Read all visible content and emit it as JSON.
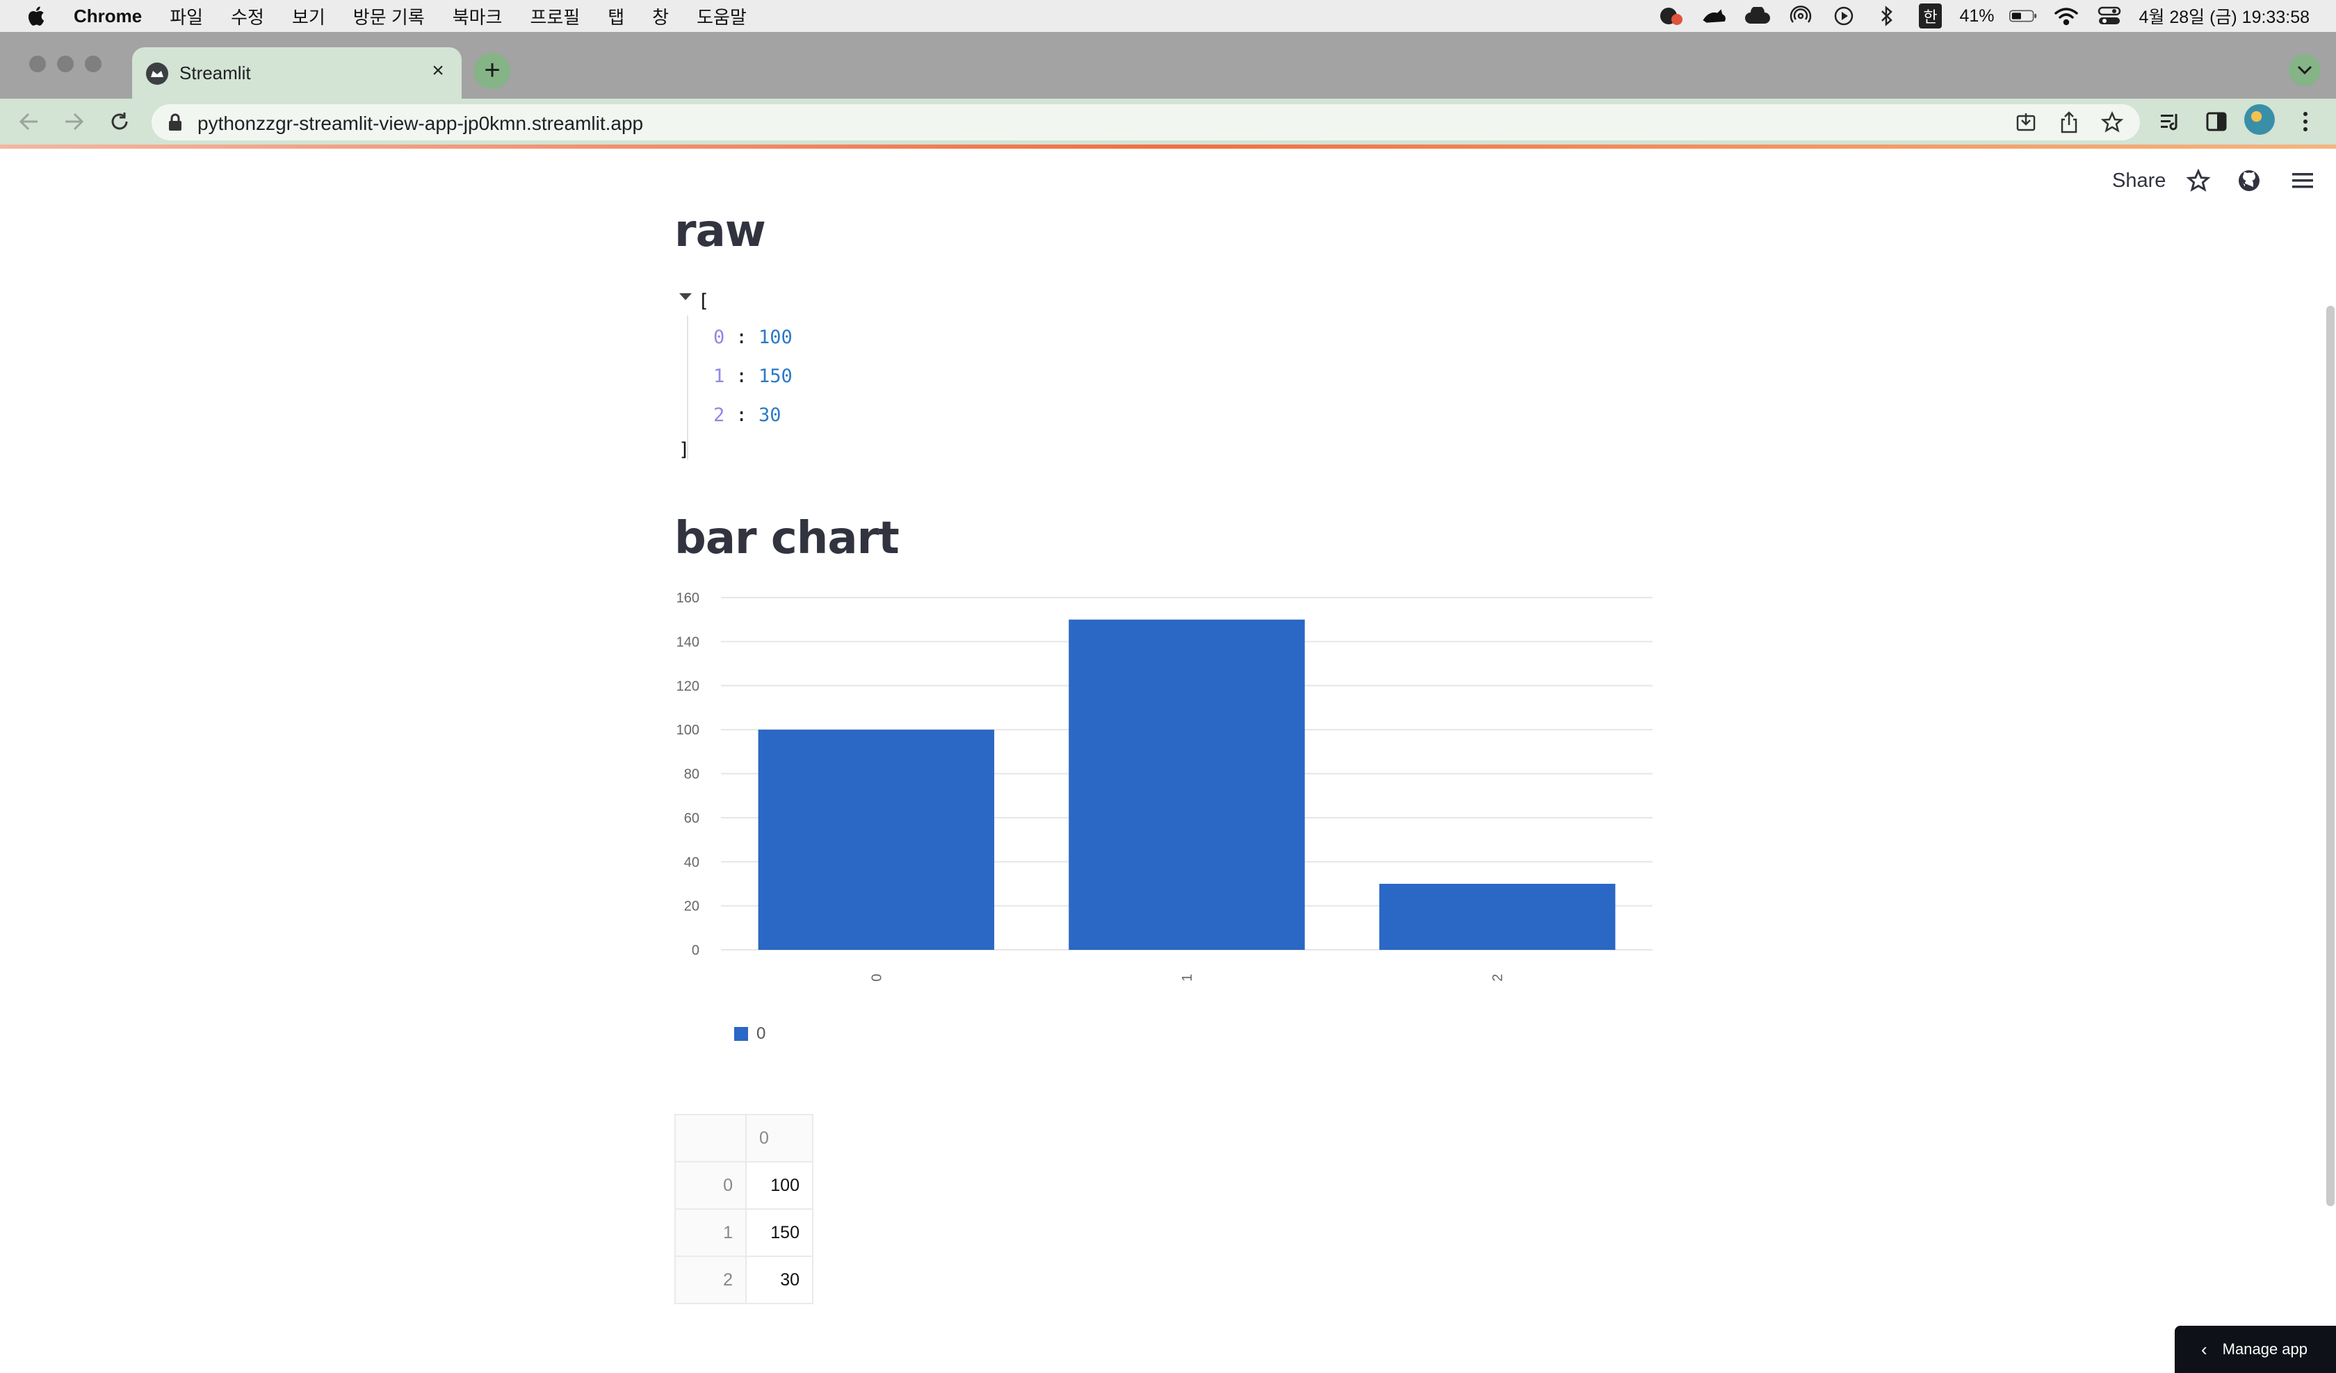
{
  "menubar": {
    "app": "Chrome",
    "items": [
      "파일",
      "수정",
      "보기",
      "방문 기록",
      "북마크",
      "프로필",
      "탭",
      "창",
      "도움말"
    ],
    "ime": "한",
    "battery": "41%",
    "datetime": "4월 28일 (금) 19:33:58"
  },
  "browser": {
    "tab_title": "Streamlit",
    "url": "pythonzzgr-streamlit-view-app-jp0kmn.streamlit.app"
  },
  "header": {
    "share_label": "Share"
  },
  "raw": {
    "title": "raw",
    "open_bracket": "[",
    "close_bracket": "]",
    "items": [
      {
        "key": "0",
        "value": "100"
      },
      {
        "key": "1",
        "value": "150"
      },
      {
        "key": "2",
        "value": "30"
      }
    ]
  },
  "bar_section": {
    "title": "bar chart"
  },
  "chart_data": {
    "type": "bar",
    "categories": [
      "0",
      "1",
      "2"
    ],
    "series": [
      {
        "name": "0",
        "values": [
          100,
          150,
          30
        ]
      }
    ],
    "ylim": [
      0,
      160
    ],
    "yticks": [
      0,
      20,
      40,
      60,
      80,
      100,
      120,
      140,
      160
    ],
    "grid": true,
    "legend": "bottom-left",
    "color": "#2b67c4"
  },
  "legend_label": "0",
  "table": {
    "header": "0",
    "rows": [
      {
        "index": "0",
        "value": "100"
      },
      {
        "index": "1",
        "value": "150"
      },
      {
        "index": "2",
        "value": "30"
      }
    ]
  },
  "manage_label": "Manage app"
}
